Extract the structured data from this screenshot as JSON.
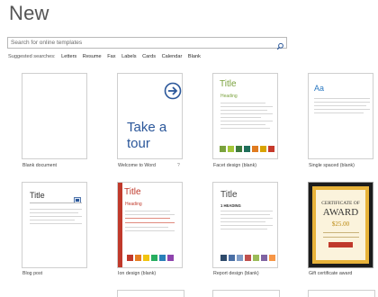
{
  "page": {
    "title": "New"
  },
  "search": {
    "placeholder": "Search for online templates"
  },
  "suggested": {
    "label": "Suggested searches:",
    "links": [
      "Letters",
      "Resume",
      "Fax",
      "Labels",
      "Cards",
      "Calendar",
      "Blank"
    ]
  },
  "templates": [
    {
      "caption": "Blank document"
    },
    {
      "caption": "Welcome to Word",
      "pin": "?",
      "tour_line1": "Take a",
      "tour_line2": "tour"
    },
    {
      "caption": "Facet design (blank)",
      "title": "Title",
      "heading": "Heading",
      "swatches": [
        "#7aa23d",
        "#a4c639",
        "#3d7a3d",
        "#1f6e5a",
        "#e07b20",
        "#d9a300",
        "#c63a2b"
      ]
    },
    {
      "caption": "Single spaced (blank)",
      "title": "Aa"
    },
    {
      "caption": "Blog post",
      "title": "Title"
    },
    {
      "caption": "Ion design (blank)",
      "title": "Title",
      "heading": "Heading",
      "swatches": [
        "#c0392b",
        "#e67e22",
        "#f1c40f",
        "#27ae60",
        "#2980b9",
        "#8e44ad"
      ]
    },
    {
      "caption": "Report design (blank)",
      "title": "Title",
      "heading": "1  HEADING",
      "swatches": [
        "#2e4a6b",
        "#4a6fa5",
        "#7f9cc7",
        "#c0504d",
        "#9bbb59",
        "#8064a2",
        "#f79646"
      ]
    },
    {
      "caption": "Gift certificate award",
      "cert_line1": "CERTIFICATE OF",
      "cert_line2": "AWARD",
      "amount": "$25.00"
    }
  ],
  "colors": {
    "accent": "#2b579a",
    "facet_green": "#7aa23d",
    "ion_red": "#c0392b",
    "cert_gold": "#e8b33a"
  },
  "icons": [
    "search-icon",
    "arrow-right-circle-icon",
    "image-icon"
  ]
}
